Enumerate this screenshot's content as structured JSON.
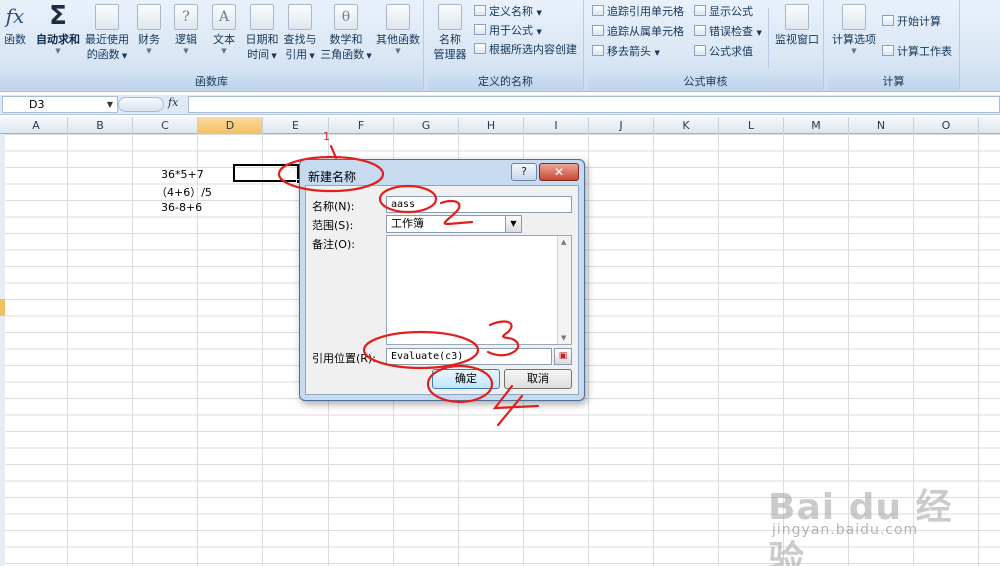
{
  "ribbon": {
    "insert_function": "函数",
    "autosum": "自动求和",
    "recent": [
      "最近使用",
      "的函数"
    ],
    "financial": "财务",
    "logical": "逻辑",
    "text": "文本",
    "datetime": [
      "日期和",
      "时间"
    ],
    "lookup": [
      "查找与",
      "引用"
    ],
    "math": [
      "数学和",
      "三角函数"
    ],
    "more": "其他函数",
    "group_library": "函数库",
    "name_manager": [
      "名称",
      "管理器"
    ],
    "define_name": "定义名称",
    "use_in_formula": "用于公式",
    "create_from_selection": "根据所选内容创建",
    "group_defined_names": "定义的名称",
    "trace_precedents": "追踪引用单元格",
    "trace_dependents": "追踪从属单元格",
    "remove_arrows": "移去箭头",
    "show_formulas": "显示公式",
    "error_checking": "错误检查",
    "evaluate_formula": "公式求值",
    "watch_window": "监视窗口",
    "group_auditing": "公式审核",
    "calc_options": "计算选项",
    "calc_now": "开始计算",
    "calc_sheet": "计算工作表",
    "group_calculation": "计算"
  },
  "formula_bar": {
    "name_box": "D3",
    "fx": "fx"
  },
  "grid": {
    "columns": [
      "A",
      "B",
      "C",
      "D",
      "E",
      "F",
      "G",
      "H",
      "I",
      "J",
      "K",
      "L",
      "M",
      "N",
      "O"
    ],
    "selected_column": "D",
    "cells": {
      "c3": "36*5+7",
      "c4": "（4+6）/5",
      "c5": "36-8+6"
    }
  },
  "dialog": {
    "title": "新建名称",
    "help": "?",
    "close": "✕",
    "name_label": "名称(N):",
    "name_value": "aass",
    "scope_label": "范围(S):",
    "scope_value": "工作簿",
    "comment_label": "备注(O):",
    "ref_label": "引用位置(R):",
    "ref_value": "Evaluate(c3)",
    "ok": "确定",
    "cancel": "取消"
  },
  "annotations": [
    "1",
    "2",
    "3",
    "4"
  ],
  "watermark": {
    "logo": "Bai du 经验",
    "url": "jingyan.baidu.com"
  },
  "colors": {
    "annotation": "#e0201c",
    "ribbon_bg": "#dbe7f5",
    "dialog_frame": "#c7dbf0",
    "selection": "#f1c15f"
  }
}
